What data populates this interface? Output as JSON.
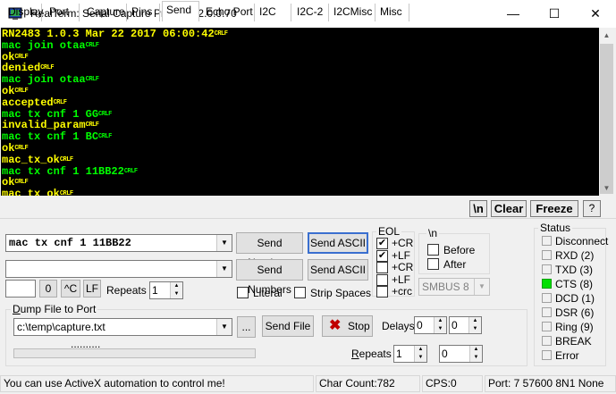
{
  "window": {
    "title": "RealTerm: Serial Capture Program 2.0.0.70"
  },
  "terminal": {
    "lines": [
      {
        "text": "RN2483 1.0.3 Mar 22 2017 06:00:42",
        "color": "#ffff00"
      },
      {
        "text": "mac join otaa",
        "color": "#00ff00"
      },
      {
        "text": "ok",
        "color": "#ffff00"
      },
      {
        "text": "denied",
        "color": "#ffff00"
      },
      {
        "text": "mac join otaa",
        "color": "#00ff00"
      },
      {
        "text": "ok",
        "color": "#ffff00"
      },
      {
        "text": "accepted",
        "color": "#ffff00"
      },
      {
        "text": "mac tx cnf 1 GG",
        "color": "#00ff00"
      },
      {
        "text": "invalid_param",
        "color": "#ffff00"
      },
      {
        "text": "mac tx cnf 1 BC",
        "color": "#00ff00"
      },
      {
        "text": "ok",
        "color": "#ffff00"
      },
      {
        "text": "mac_tx_ok",
        "color": "#ffff00"
      },
      {
        "text": "mac tx cnf 1 11BB22",
        "color": "#00ff00"
      },
      {
        "text": "ok",
        "color": "#ffff00"
      },
      {
        "text": "mac_tx_ok",
        "color": "#ffff00"
      }
    ],
    "crlf_label": "CRLF"
  },
  "tabs": [
    "Display",
    "Port",
    "Capture",
    "Pins",
    "Send",
    "Echo Port",
    "I2C",
    "I2C-2",
    "I2CMisc",
    "Misc"
  ],
  "active_tab": "Send",
  "right_buttons": {
    "n": "\\n",
    "clear": "Clear",
    "freeze": "Freeze",
    "help": "?"
  },
  "send": {
    "combo1_value": "mac tx cnf 1 11BB22",
    "combo2_value": "",
    "send_numbers": "Send Numbers",
    "send_ascii": "Send ASCII",
    "zero_value": "",
    "zero_btn": "0",
    "ctrl_c": "^C",
    "lf_btn": "LF",
    "repeats_label": "Repeats",
    "repeats_value": "1",
    "literal": "Literal",
    "strip_spaces": "Strip Spaces",
    "eol_title": "EOL",
    "eol_items": [
      {
        "label": "+CR",
        "checked": true
      },
      {
        "label": "+LF",
        "checked": true
      },
      {
        "label": "+CR",
        "checked": false
      },
      {
        "label": "+LF",
        "checked": false
      },
      {
        "label": "+crc",
        "checked": false
      }
    ],
    "n_title": "\\n",
    "before": "Before",
    "after": "After",
    "smbus": "SMBUS 8"
  },
  "dump": {
    "title": "Dump File to Port",
    "file": "c:\\temp\\capture.txt",
    "browse": "...",
    "send_file": "Send File",
    "stop": "Stop",
    "delays_label": "Delays",
    "delay1": "0",
    "delay2": "0",
    "progress": "..........",
    "repeats_label": "Repeats",
    "repeats1": "1",
    "repeats2": "0"
  },
  "status": {
    "title": "Status",
    "items": [
      {
        "label": "Disconnect",
        "on": false
      },
      {
        "label": "RXD (2)",
        "on": false
      },
      {
        "label": "TXD (3)",
        "on": false
      },
      {
        "label": "CTS (8)",
        "on": true
      },
      {
        "label": "DCD (1)",
        "on": false
      },
      {
        "label": "DSR (6)",
        "on": false
      },
      {
        "label": "Ring (9)",
        "on": false
      },
      {
        "label": "BREAK",
        "on": false
      },
      {
        "label": "Error",
        "on": false
      }
    ]
  },
  "statusbar": {
    "message": "You can use ActiveX automation to control me!",
    "char_count": "Char Count:782",
    "cps": "CPS:0",
    "port": "Port: 7 57600 8N1 None"
  }
}
